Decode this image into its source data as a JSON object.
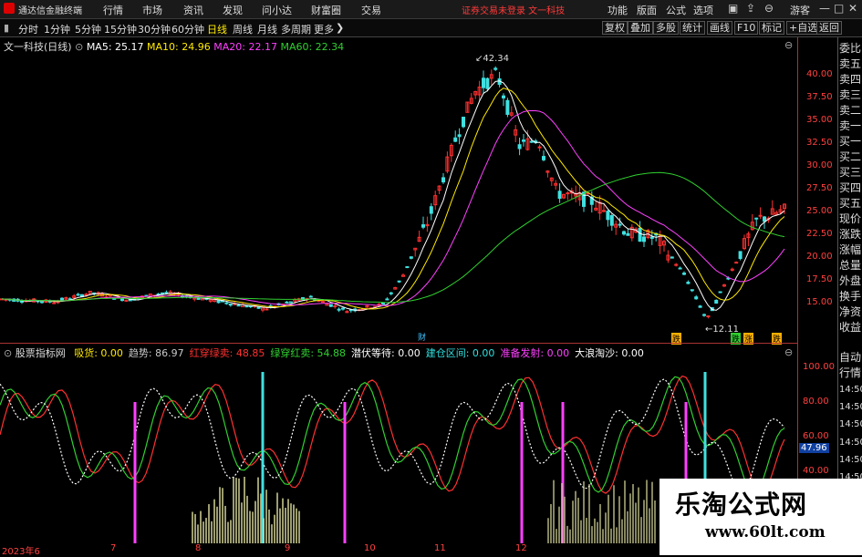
{
  "menubar": {
    "app_name": "通达信金融终端",
    "items": [
      "行情",
      "市场",
      "资讯",
      "发现",
      "问小达",
      "财富圈",
      "交易"
    ],
    "status": "证券交易未登录  文一科技",
    "right_items": [
      "功能",
      "版面",
      "公式",
      "选项"
    ],
    "guest": "游客"
  },
  "periods": [
    "分时",
    "1分钟",
    "5分钟",
    "15分钟",
    "30分钟",
    "60分钟",
    "日线",
    "周线",
    "月线",
    "多周期",
    "更多"
  ],
  "active_period": "日线",
  "tools": [
    "复权",
    "叠加",
    "多股",
    "统计",
    "画线",
    "F10",
    "标记",
    "+自选",
    "返回"
  ],
  "main": {
    "title": "文一科技(日线)",
    "ma5": "MA5: 25.17",
    "ma10": "MA10: 24.96",
    "ma20": "MA20: 22.17",
    "ma60": "MA60: 22.34",
    "high_label": "42.34",
    "low_label": "12.11",
    "y_ticks": [
      "40.00",
      "37.50",
      "35.00",
      "32.50",
      "30.00",
      "27.50",
      "25.00",
      "22.50",
      "20.00",
      "17.50",
      "15.00"
    ],
    "markers": [
      "财",
      "跌",
      "跌",
      "涨",
      "跌"
    ]
  },
  "indicator": {
    "name": "股票指标网",
    "items": [
      {
        "label": "吸货: 0.00",
        "color": "#ffea00"
      },
      {
        "label": "趋势: 86.97",
        "color": "#c8c8c8"
      },
      {
        "label": "红穿绿卖: 48.85",
        "color": "#ff3030"
      },
      {
        "label": "绿穿红卖: 54.88",
        "color": "#30d030"
      },
      {
        "label": "潜伏等待: 0.00",
        "color": "#ffffff"
      },
      {
        "label": "建仓区间: 0.00",
        "color": "#30e0e0"
      },
      {
        "label": "准备发射: 0.00",
        "color": "#ff40ff"
      },
      {
        "label": "大浪淘沙: 0.00",
        "color": "#ffffff"
      }
    ],
    "y_ticks": [
      "100.00",
      "80.00",
      "60.00",
      "40.00"
    ],
    "current_value": "47.96"
  },
  "x_dates": [
    "2023年6",
    "7",
    "8",
    "9",
    "10",
    "11",
    "12"
  ],
  "right_panel": [
    "委比",
    "卖五",
    "卖四",
    "卖三",
    "卖二",
    "卖一",
    "买一",
    "买二",
    "买三",
    "买四",
    "买五",
    "现价",
    "涨跌",
    "涨幅",
    "总量",
    "外盘",
    "换手",
    "净资",
    "收益",
    "自动",
    "行情",
    "14:50",
    "14:50",
    "14:50",
    "14:50",
    "14:50",
    "14:50",
    "14:50",
    "14:50"
  ],
  "watermark": {
    "title": "乐淘公式网",
    "url": "www.60lt.com"
  },
  "colors": {
    "up": "#ff3030",
    "down": "#40e0e0",
    "ma5": "#ffffff",
    "ma10": "#ffea00",
    "ma20": "#ff40ff",
    "ma60": "#30d030"
  }
}
